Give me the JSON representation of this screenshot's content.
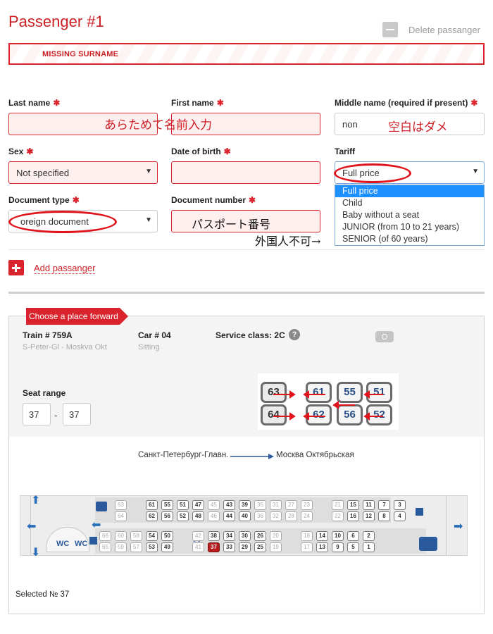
{
  "header": {
    "title": "Passenger #1",
    "delete_label": "Delete passanger",
    "error_banner": "MISSING SURNAME"
  },
  "form": {
    "last_name": {
      "label": "Last name",
      "value": ""
    },
    "first_name": {
      "label": "First name",
      "value": ""
    },
    "middle_name": {
      "label": "Middle name (required if present)",
      "value": "non"
    },
    "sex": {
      "label": "Sex",
      "value": "Not specified"
    },
    "dob": {
      "label": "Date of birth",
      "value": ""
    },
    "tariff": {
      "label": "Tariff",
      "value": "Full price",
      "options": [
        "Full price",
        "Child",
        "Baby without a seat",
        "JUNIOR (from 10 to 21 years)",
        "SENIOR (of 60 years)"
      ]
    },
    "doc_type": {
      "label": "Document type",
      "value": "oreign document"
    },
    "doc_number": {
      "label": "Document number",
      "value": ""
    },
    "add_passenger": "Add passanger"
  },
  "annotations": {
    "name_again": "あらためて名前入力",
    "blank_bad": "空白はダメ",
    "passport_no": "パスポート番号",
    "foreigner_no": "外国人不可→"
  },
  "train": {
    "tag": "Choose a place forward",
    "train_no": "Train # 759A",
    "train_route": "S-Peter-Gl - Moskva Okt",
    "car_no": "Car # 04",
    "car_type": "Sitting",
    "service_class": "Service class: 2C",
    "help": "?",
    "seat_range_label": "Seat range",
    "range_from": "37",
    "range_sep": "-",
    "range_to": "37",
    "route_from": "Санкт-Петербург-Главн.",
    "route_to": "Москва Октябрьская",
    "selected": "Selected № 37",
    "wc": "WC"
  },
  "seat_preview": {
    "top": [
      "63",
      "61",
      "55",
      "51"
    ],
    "bottom": [
      "64",
      "62",
      "56",
      "52"
    ]
  },
  "car_map": {
    "row1": [
      "63",
      "",
      "61",
      "55",
      "51",
      "47",
      "45",
      "43",
      "39",
      "35",
      "31",
      "27",
      "23",
      "",
      "21",
      "15",
      "11",
      "7",
      "3"
    ],
    "row2": [
      "64",
      "",
      "62",
      "56",
      "52",
      "48",
      "46",
      "44",
      "40",
      "36",
      "32",
      "28",
      "24",
      "",
      "22",
      "16",
      "12",
      "8",
      "4"
    ],
    "row3": [
      "66",
      "60",
      "58",
      "54",
      "50",
      "",
      "42",
      "38",
      "34",
      "30",
      "26",
      "20",
      "",
      "18",
      "14",
      "10",
      "6",
      "2"
    ],
    "row4": [
      "65",
      "59",
      "57",
      "53",
      "49",
      "",
      "41",
      "37",
      "33",
      "29",
      "25",
      "19",
      "",
      "17",
      "13",
      "9",
      "5",
      "1"
    ]
  },
  "colors": {
    "accent": "#d9232d",
    "selected_seat": "#b71c1c",
    "dropdown_highlight": "#1e90ff"
  }
}
